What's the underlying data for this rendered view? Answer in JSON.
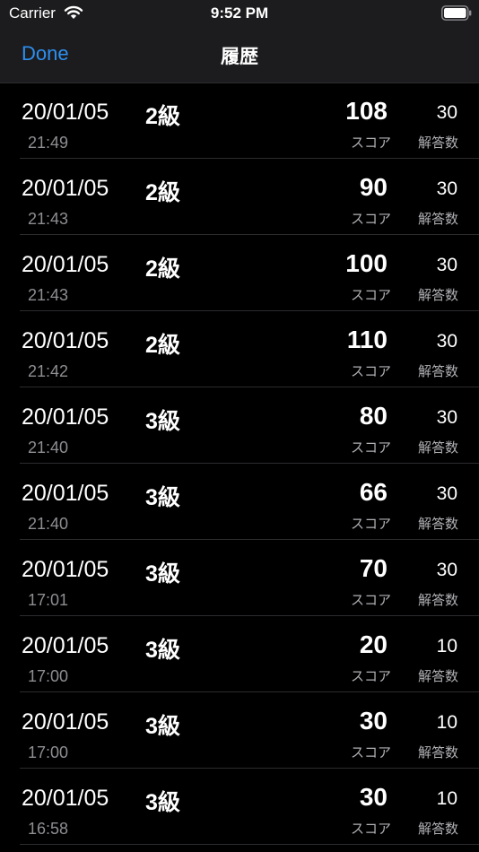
{
  "status_bar": {
    "carrier": "Carrier",
    "time": "9:52 PM"
  },
  "nav": {
    "done_label": "Done",
    "title": "履歴"
  },
  "labels": {
    "score": "スコア",
    "answers": "解答数"
  },
  "rows": [
    {
      "date": "20/01/05",
      "grade": "2級",
      "time": "21:49",
      "score": "108",
      "answers": "30"
    },
    {
      "date": "20/01/05",
      "grade": "2級",
      "time": "21:43",
      "score": "90",
      "answers": "30"
    },
    {
      "date": "20/01/05",
      "grade": "2級",
      "time": "21:43",
      "score": "100",
      "answers": "30"
    },
    {
      "date": "20/01/05",
      "grade": "2級",
      "time": "21:42",
      "score": "110",
      "answers": "30"
    },
    {
      "date": "20/01/05",
      "grade": "3級",
      "time": "21:40",
      "score": "80",
      "answers": "30"
    },
    {
      "date": "20/01/05",
      "grade": "3級",
      "time": "21:40",
      "score": "66",
      "answers": "30"
    },
    {
      "date": "20/01/05",
      "grade": "3級",
      "time": "17:01",
      "score": "70",
      "answers": "30"
    },
    {
      "date": "20/01/05",
      "grade": "3級",
      "time": "17:00",
      "score": "20",
      "answers": "10"
    },
    {
      "date": "20/01/05",
      "grade": "3級",
      "time": "17:00",
      "score": "30",
      "answers": "10"
    },
    {
      "date": "20/01/05",
      "grade": "3級",
      "time": "16:58",
      "score": "30",
      "answers": "10"
    }
  ]
}
